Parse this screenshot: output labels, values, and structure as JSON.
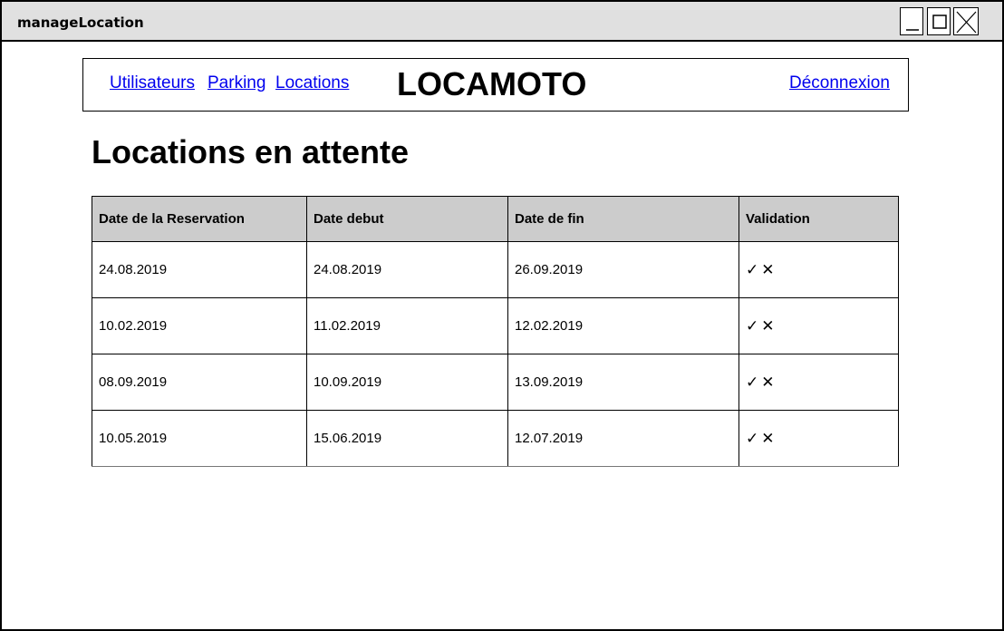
{
  "window": {
    "title": "manageLocation"
  },
  "nav": {
    "links": [
      "Utilisateurs",
      "Parking",
      "Locations"
    ],
    "brand": "LOCAMOTO",
    "logout": "Déconnexion"
  },
  "page": {
    "title": "Locations en attente"
  },
  "table": {
    "headers": [
      "Date de la Reservation",
      "Date debut",
      "Date de fin",
      "Validation"
    ],
    "rows": [
      {
        "reservation": "24.08.2019",
        "debut": "24.08.2019",
        "fin": "26.09.2019",
        "validate": "✓",
        "reject": "✕"
      },
      {
        "reservation": "10.02.2019",
        "debut": "11.02.2019",
        "fin": "12.02.2019",
        "validate": "✓",
        "reject": "✕"
      },
      {
        "reservation": "08.09.2019",
        "debut": "10.09.2019",
        "fin": "13.09.2019",
        "validate": "✓",
        "reject": "✕"
      },
      {
        "reservation": "10.05.2019",
        "debut": "15.06.2019",
        "fin": "12.07.2019",
        "validate": "✓",
        "reject": "✕"
      }
    ]
  },
  "colors": {
    "link": "#0000ee",
    "header_bg": "#cccccc",
    "titlebar_bg": "#e0e0e0"
  }
}
